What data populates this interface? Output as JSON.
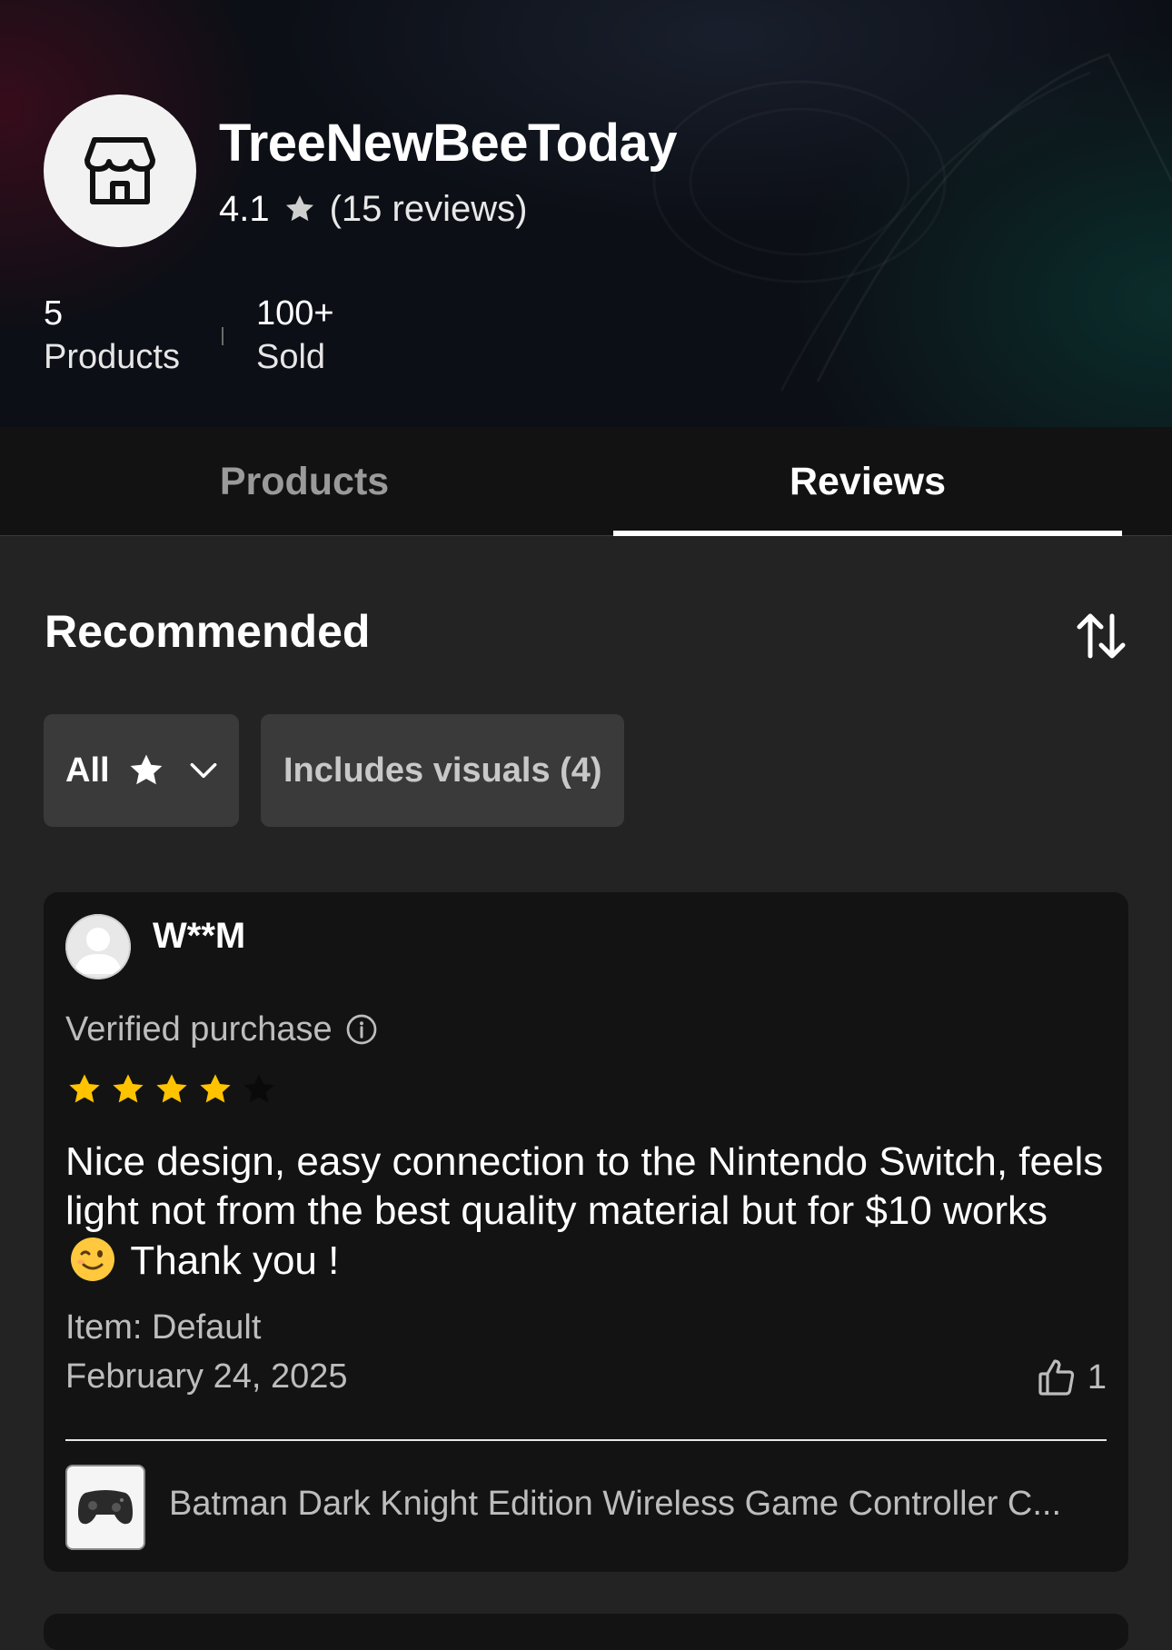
{
  "shop": {
    "name": "TreeNewBeeToday",
    "rating": "4.1",
    "reviews_count": "(15 reviews)",
    "products_count": "5",
    "products_label": "Products",
    "sold_count": "100+",
    "sold_label": "Sold"
  },
  "tabs": [
    {
      "label": "Products",
      "active": false
    },
    {
      "label": "Reviews",
      "active": true
    }
  ],
  "section": {
    "title": "Recommended"
  },
  "filters": {
    "rating_filter_label": "All",
    "visuals_filter_label": "Includes visuals (4)"
  },
  "review": {
    "user": "W**M",
    "verified_label": "Verified purchase",
    "stars": 4,
    "stars_max": 5,
    "text_part1": "Nice design, easy connection to the Nintendo Switch, feels light not from the best quality material but for $10 works",
    "text_part2": "Thank you !",
    "item_label": "Item: Default",
    "date": "February 24, 2025",
    "likes": "1",
    "product_title": "Batman Dark Knight Edition Wireless Game Controller C..."
  },
  "colors": {
    "star_filled": "#FFC300",
    "star_empty": "#0a0a0a",
    "tab_active": "#FFFFFF",
    "tab_inactive": "#9A9A9A"
  }
}
